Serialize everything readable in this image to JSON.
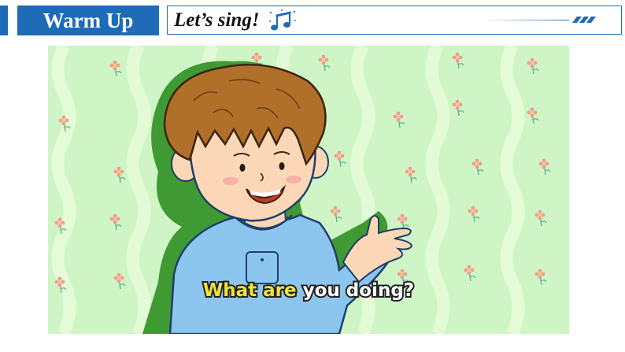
{
  "header": {
    "section_tag": "Warm Up",
    "title": "Let’s sing!"
  },
  "video": {
    "subtitle_highlight": "What are",
    "subtitle_rest": " you doing?"
  },
  "colors": {
    "accent": "#1e6bb8",
    "background_green": "#cff5c6",
    "highlight_yellow": "#f2e33a",
    "shirt_blue": "#8cc6ef",
    "hair_brown": "#b0702a"
  },
  "icons": [
    "music-note-icon"
  ]
}
